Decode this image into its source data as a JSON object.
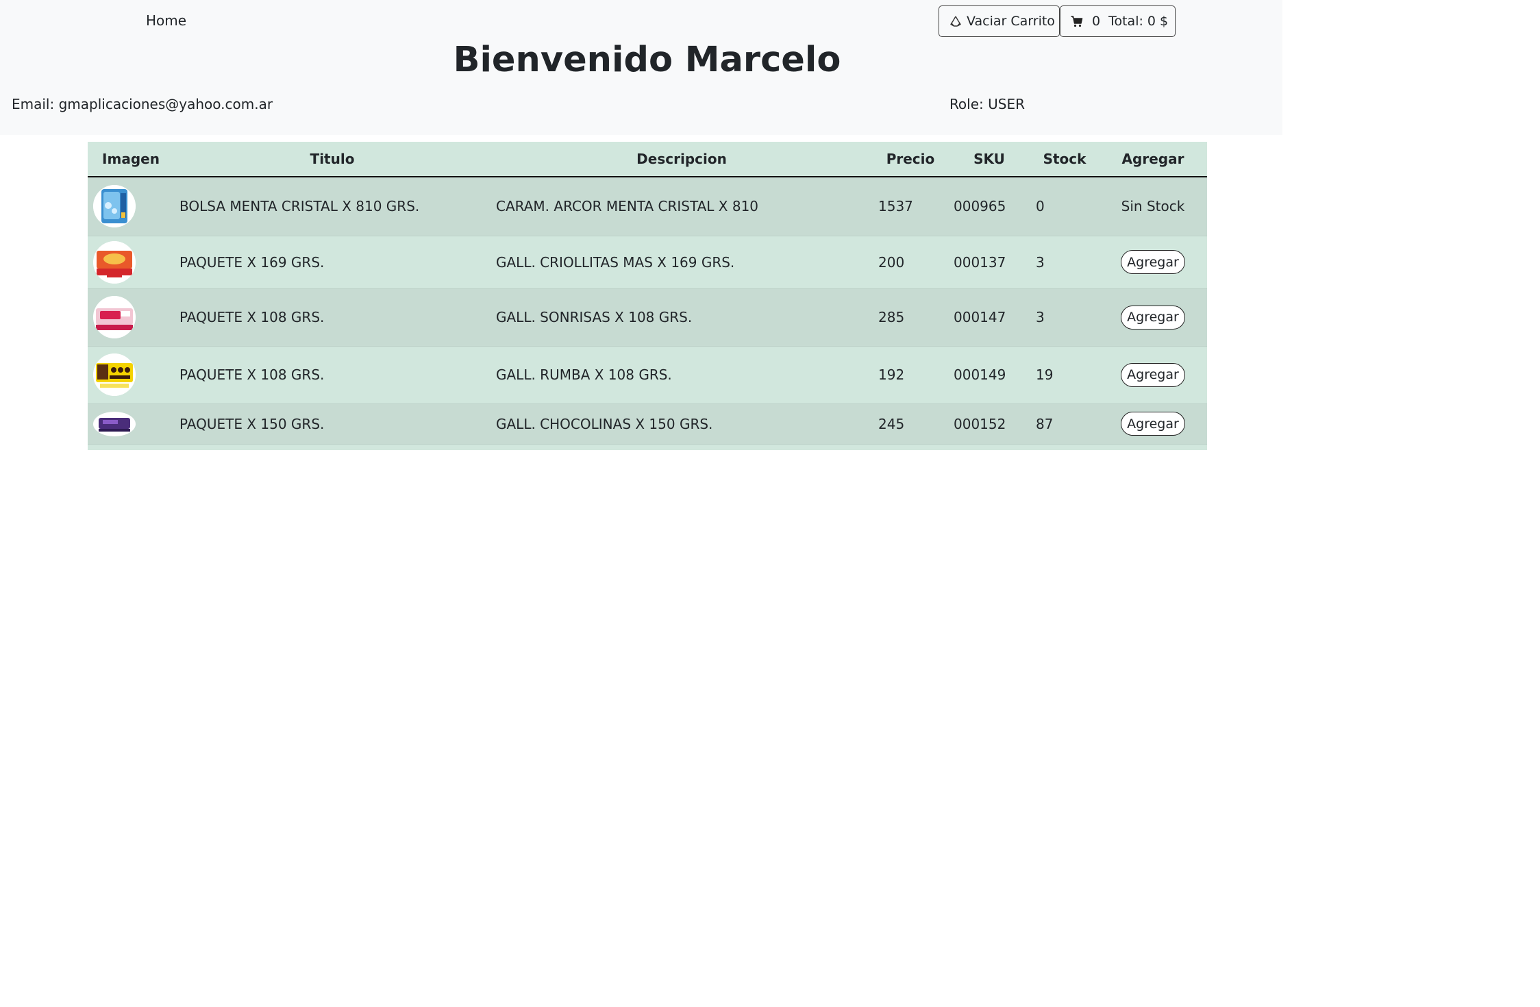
{
  "nav": {
    "home_label": "Home"
  },
  "actions": {
    "vaciar_label": "Vaciar Carrito",
    "cart_count": "0",
    "cart_total": "Total: 0 $"
  },
  "welcome": {
    "title": "Bienvenido Marcelo",
    "email": "Email: gmaplicaciones@yahoo.com.ar",
    "role": "Role: USER"
  },
  "table": {
    "headers": [
      "Imagen",
      "Titulo",
      "Descripcion",
      "Precio",
      "SKU",
      "Stock",
      "Agregar"
    ],
    "rows": [
      {
        "titulo": "BOLSA MENTA CRISTAL X 810 GRS.",
        "descripcion": "CARAM. ARCOR MENTA CRISTAL X 810",
        "precio": "1537",
        "sku": "000965",
        "stock": "0",
        "action": "Sin Stock"
      },
      {
        "titulo": "PAQUETE X 169 GRS.",
        "descripcion": "GALL. CRIOLLITAS MAS X 169 GRS.",
        "precio": "200",
        "sku": "000137",
        "stock": "3",
        "action": "Agregar"
      },
      {
        "titulo": "PAQUETE X 108 GRS.",
        "descripcion": "GALL. SONRISAS X 108 GRS.",
        "precio": "285",
        "sku": "000147",
        "stock": "3",
        "action": "Agregar"
      },
      {
        "titulo": "PAQUETE X 108 GRS.",
        "descripcion": "GALL. RUMBA X 108 GRS.",
        "precio": "192",
        "sku": "000149",
        "stock": "19",
        "action": "Agregar"
      },
      {
        "titulo": "PAQUETE X 150 GRS.",
        "descripcion": "GALL. CHOCOLINAS X 150 GRS.",
        "precio": "245",
        "sku": "000152",
        "stock": "87",
        "action": "Agregar"
      }
    ]
  },
  "colors": {
    "header_bg": "#f8f9fa",
    "table_bg": "#d1e7dd",
    "table_row_alt": "#c7dbd2"
  }
}
